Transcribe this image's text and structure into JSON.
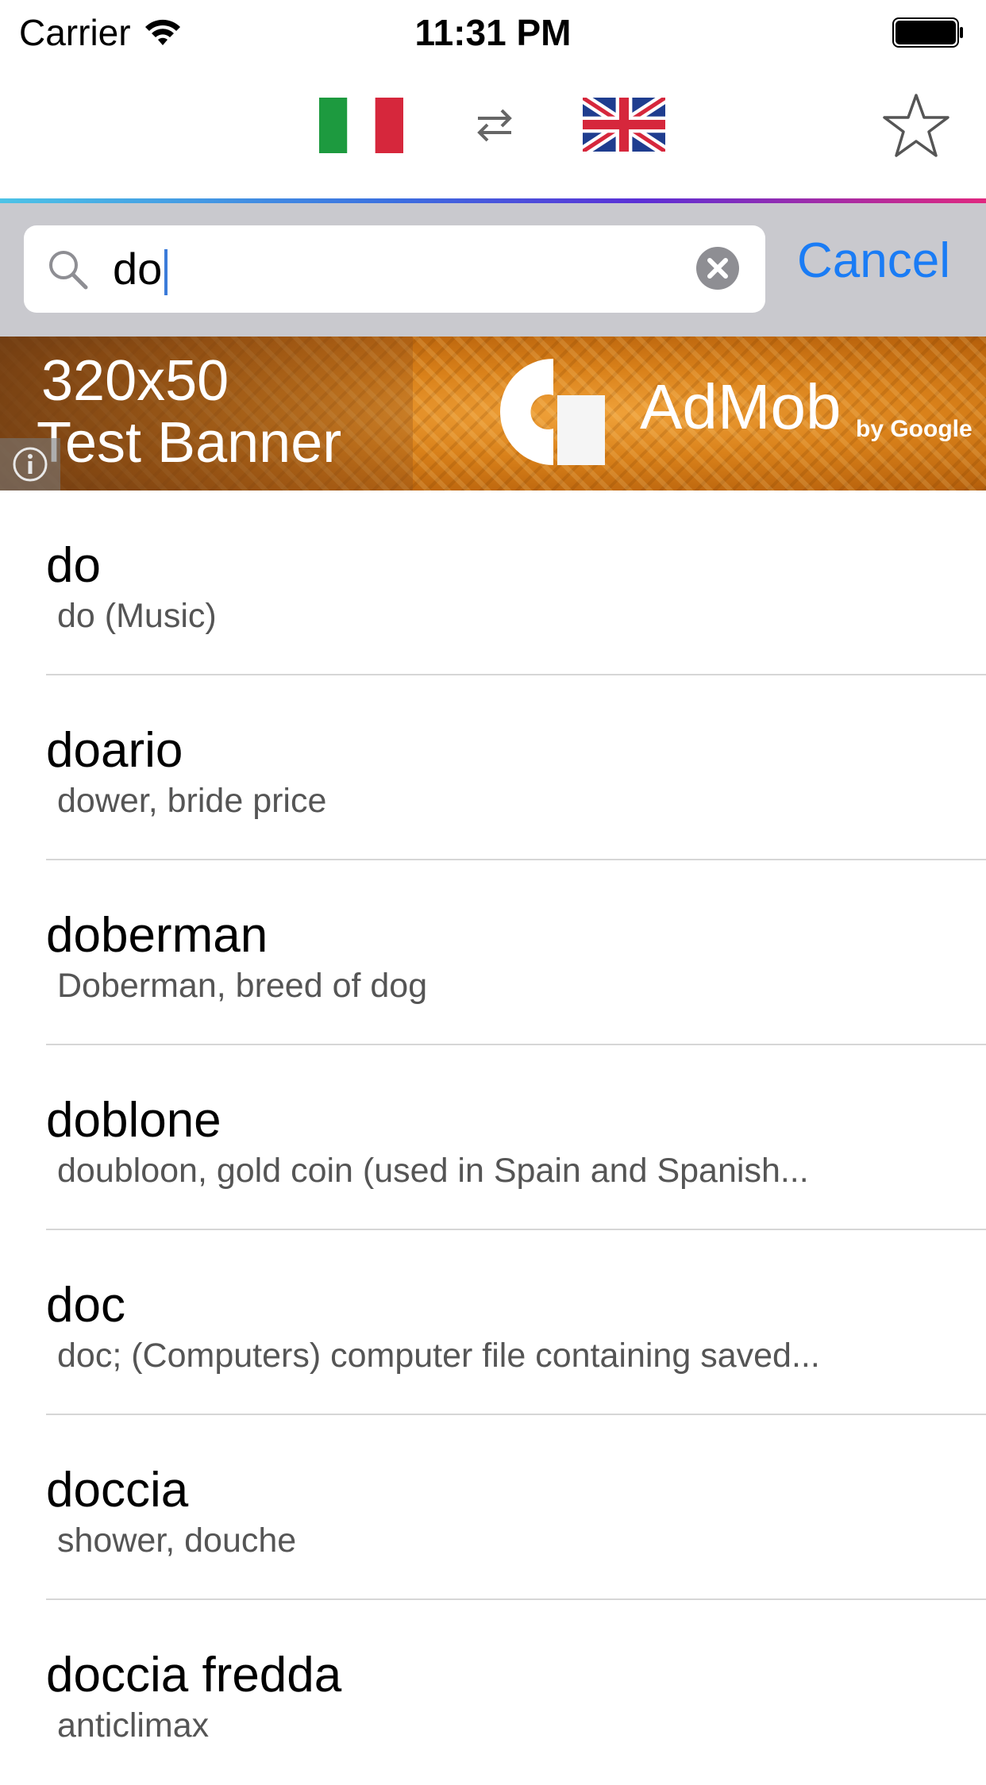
{
  "status_bar": {
    "carrier": "Carrier",
    "time": "11:31 PM"
  },
  "nav": {
    "source_language_flag": "italy-flag-icon",
    "target_language_flag": "uk-flag-icon",
    "swap_icon": "swap-arrows-icon",
    "favorites_icon": "star-icon"
  },
  "search": {
    "query": "do",
    "cancel_label": "Cancel"
  },
  "ad_banner": {
    "size_text": "320x50",
    "label": "Test Banner",
    "brand": "AdMob",
    "brand_sub": "by Google"
  },
  "results": [
    {
      "word": "do",
      "definition": "do (Music)"
    },
    {
      "word": "doario",
      "definition": "dower, bride price"
    },
    {
      "word": "doberman",
      "definition": "Doberman, breed of dog"
    },
    {
      "word": "doblone",
      "definition": "doubloon, gold coin (used in Spain and Spanish..."
    },
    {
      "word": "doc",
      "definition": "doc; (Computers) computer file containing saved..."
    },
    {
      "word": "doccia",
      "definition": "shower, douche"
    },
    {
      "word": "doccia fredda",
      "definition": "anticlimax"
    }
  ],
  "colors": {
    "accent": "#1a7cf5",
    "search_background": "#c9c9ce"
  }
}
